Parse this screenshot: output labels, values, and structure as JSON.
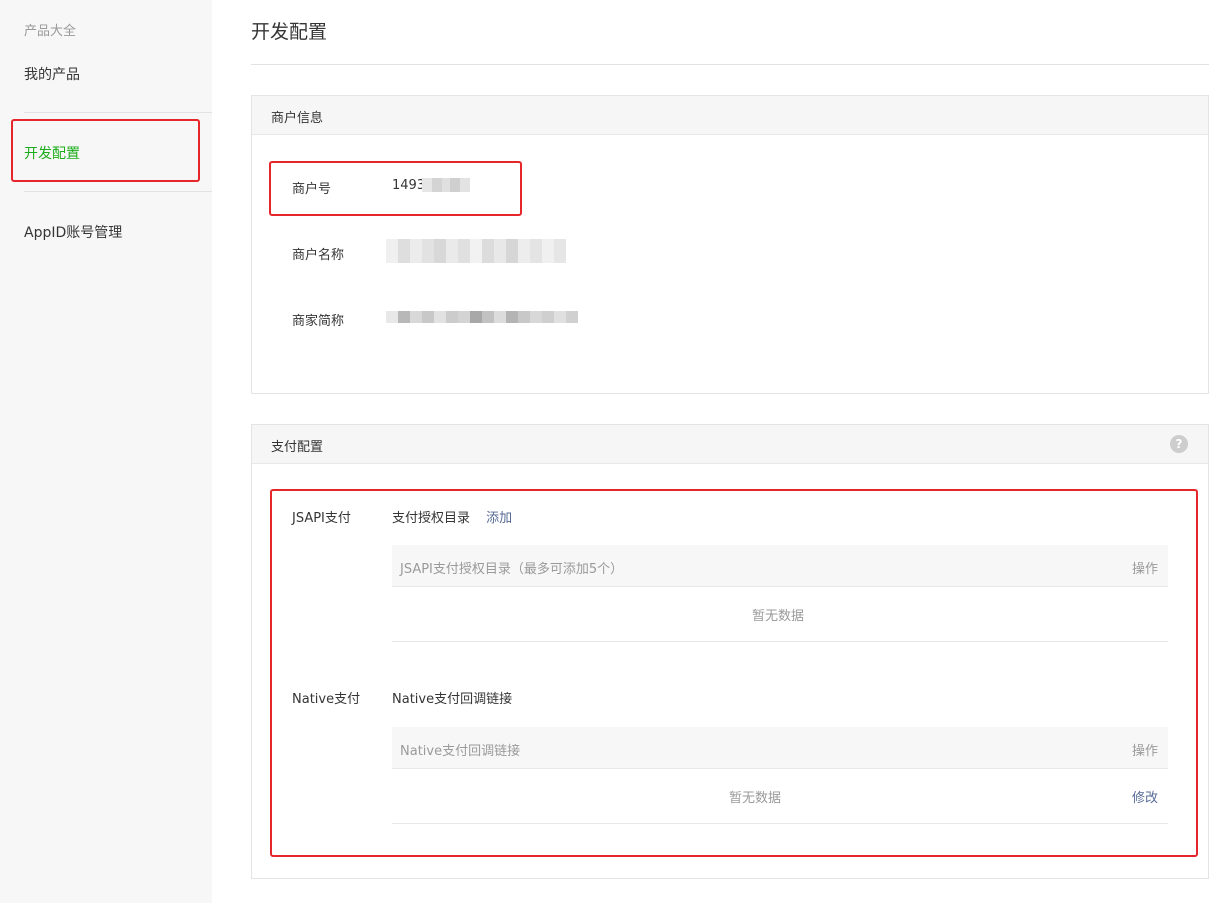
{
  "sidebar": {
    "heading": "产品大全",
    "items": [
      {
        "label": "我的产品"
      },
      {
        "label": "开发配置"
      },
      {
        "label": "AppID账号管理"
      }
    ]
  },
  "page": {
    "title": "开发配置"
  },
  "merchant_info": {
    "title": "商户信息",
    "merchant_id_label": "商户号",
    "merchant_id_value": "1493",
    "merchant_name_label": "商户名称",
    "merchant_short_label": "商家简称"
  },
  "pay_config": {
    "title": "支付配置",
    "help_icon": "question-circle-icon",
    "jsapi": {
      "label": "JSAPI支付",
      "sub_title": "支付授权目录",
      "add_link": "添加",
      "table_header": "JSAPI支付授权目录（最多可添加5个）",
      "action_header": "操作",
      "empty": "暂无数据"
    },
    "native": {
      "label": "Native支付",
      "sub_title": "Native支付回调链接",
      "table_header": "Native支付回调链接",
      "action_header": "操作",
      "empty": "暂无数据",
      "edit_link": "修改"
    }
  },
  "colors": {
    "active_nav": "#1aad19",
    "link": "#576b95",
    "highlight": "#e5262a"
  }
}
